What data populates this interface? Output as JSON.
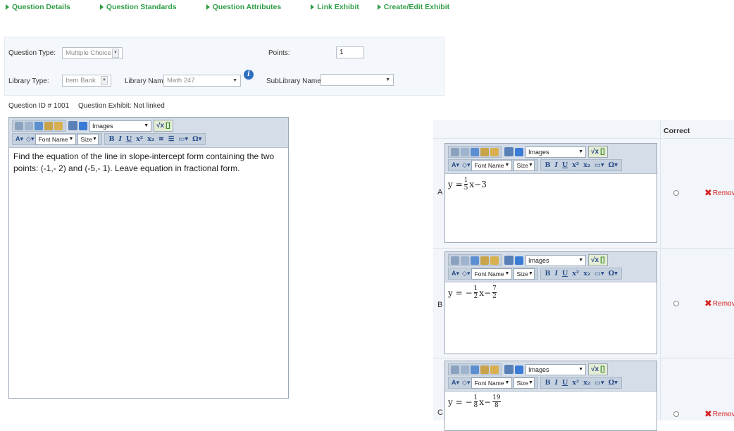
{
  "tabs": [
    {
      "label": "Question Details"
    },
    {
      "label": "Question Standards"
    },
    {
      "label": "Question Attributes"
    },
    {
      "label": "Link Exhibit"
    },
    {
      "label": "Create/Edit Exhibit"
    }
  ],
  "settings": {
    "question_type_label": "Question Type:",
    "question_type_value": "Multiple Choice",
    "points_label": "Points:",
    "points_value": "1",
    "library_type_label": "Library Type:",
    "library_type_value": "Item Bank",
    "library_name_label": "Library Name:",
    "library_name_value": "Math 247",
    "sublibrary_label": "SubLibrary Name:",
    "sublibrary_value": ""
  },
  "question_info": {
    "id_text": "Question ID # 1001",
    "exhibit_text": "Question Exhibit:  Not linked"
  },
  "editor_toolbar": {
    "images_label": "Images",
    "font_name_label": "Font Name",
    "size_label": "Size"
  },
  "question_text": "Find the equation of the line in slope-intercept form containing the two points:  (-1,- 2) and (-5,- 1).  Leave equation in fractional form.",
  "answers_header": {
    "correct_label": "Correct"
  },
  "answers": [
    {
      "letter": "A",
      "eq_prefix": "y = ",
      "frac_num": "1",
      "frac_den": "5",
      "eq_mid": " x−3",
      "frac2_num": "",
      "frac2_den": "",
      "remove_label": "Remov"
    },
    {
      "letter": "B",
      "eq_prefix": "y = −",
      "frac_num": "1",
      "frac_den": "2",
      "eq_mid": " x−",
      "frac2_num": "7",
      "frac2_den": "2",
      "remove_label": "Remov"
    },
    {
      "letter": "C",
      "eq_prefix": "y = −",
      "frac_num": "1",
      "frac_den": "8",
      "eq_mid": "x−",
      "frac2_num": "19",
      "frac2_den": "8",
      "remove_label": "Remov"
    }
  ],
  "colors": {
    "tab_green": "#2e9e46",
    "remove_red": "#d62121",
    "toolbar_blue": "#d5dde8"
  }
}
